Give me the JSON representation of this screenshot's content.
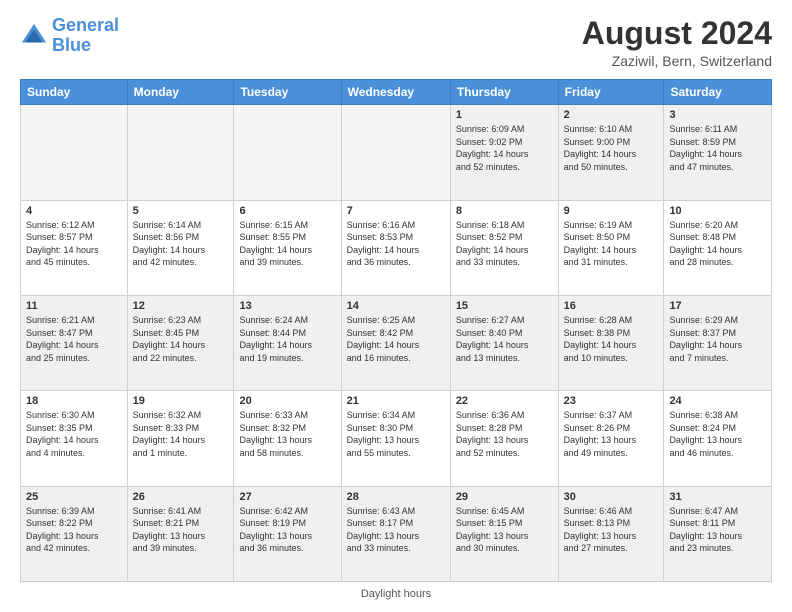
{
  "header": {
    "logo_line1": "General",
    "logo_line2": "Blue",
    "month_title": "August 2024",
    "location": "Zaziwil, Bern, Switzerland"
  },
  "footer": {
    "note": "Daylight hours"
  },
  "weekdays": [
    "Sunday",
    "Monday",
    "Tuesday",
    "Wednesday",
    "Thursday",
    "Friday",
    "Saturday"
  ],
  "weeks": [
    [
      {
        "day": "",
        "info": "",
        "empty": true
      },
      {
        "day": "",
        "info": "",
        "empty": true
      },
      {
        "day": "",
        "info": "",
        "empty": true
      },
      {
        "day": "",
        "info": "",
        "empty": true
      },
      {
        "day": "1",
        "info": "Sunrise: 6:09 AM\nSunset: 9:02 PM\nDaylight: 14 hours\nand 52 minutes.",
        "empty": false
      },
      {
        "day": "2",
        "info": "Sunrise: 6:10 AM\nSunset: 9:00 PM\nDaylight: 14 hours\nand 50 minutes.",
        "empty": false
      },
      {
        "day": "3",
        "info": "Sunrise: 6:11 AM\nSunset: 8:59 PM\nDaylight: 14 hours\nand 47 minutes.",
        "empty": false
      }
    ],
    [
      {
        "day": "4",
        "info": "Sunrise: 6:12 AM\nSunset: 8:57 PM\nDaylight: 14 hours\nand 45 minutes.",
        "empty": false
      },
      {
        "day": "5",
        "info": "Sunrise: 6:14 AM\nSunset: 8:56 PM\nDaylight: 14 hours\nand 42 minutes.",
        "empty": false
      },
      {
        "day": "6",
        "info": "Sunrise: 6:15 AM\nSunset: 8:55 PM\nDaylight: 14 hours\nand 39 minutes.",
        "empty": false
      },
      {
        "day": "7",
        "info": "Sunrise: 6:16 AM\nSunset: 8:53 PM\nDaylight: 14 hours\nand 36 minutes.",
        "empty": false
      },
      {
        "day": "8",
        "info": "Sunrise: 6:18 AM\nSunset: 8:52 PM\nDaylight: 14 hours\nand 33 minutes.",
        "empty": false
      },
      {
        "day": "9",
        "info": "Sunrise: 6:19 AM\nSunset: 8:50 PM\nDaylight: 14 hours\nand 31 minutes.",
        "empty": false
      },
      {
        "day": "10",
        "info": "Sunrise: 6:20 AM\nSunset: 8:48 PM\nDaylight: 14 hours\nand 28 minutes.",
        "empty": false
      }
    ],
    [
      {
        "day": "11",
        "info": "Sunrise: 6:21 AM\nSunset: 8:47 PM\nDaylight: 14 hours\nand 25 minutes.",
        "empty": false
      },
      {
        "day": "12",
        "info": "Sunrise: 6:23 AM\nSunset: 8:45 PM\nDaylight: 14 hours\nand 22 minutes.",
        "empty": false
      },
      {
        "day": "13",
        "info": "Sunrise: 6:24 AM\nSunset: 8:44 PM\nDaylight: 14 hours\nand 19 minutes.",
        "empty": false
      },
      {
        "day": "14",
        "info": "Sunrise: 6:25 AM\nSunset: 8:42 PM\nDaylight: 14 hours\nand 16 minutes.",
        "empty": false
      },
      {
        "day": "15",
        "info": "Sunrise: 6:27 AM\nSunset: 8:40 PM\nDaylight: 14 hours\nand 13 minutes.",
        "empty": false
      },
      {
        "day": "16",
        "info": "Sunrise: 6:28 AM\nSunset: 8:38 PM\nDaylight: 14 hours\nand 10 minutes.",
        "empty": false
      },
      {
        "day": "17",
        "info": "Sunrise: 6:29 AM\nSunset: 8:37 PM\nDaylight: 14 hours\nand 7 minutes.",
        "empty": false
      }
    ],
    [
      {
        "day": "18",
        "info": "Sunrise: 6:30 AM\nSunset: 8:35 PM\nDaylight: 14 hours\nand 4 minutes.",
        "empty": false
      },
      {
        "day": "19",
        "info": "Sunrise: 6:32 AM\nSunset: 8:33 PM\nDaylight: 14 hours\nand 1 minute.",
        "empty": false
      },
      {
        "day": "20",
        "info": "Sunrise: 6:33 AM\nSunset: 8:32 PM\nDaylight: 13 hours\nand 58 minutes.",
        "empty": false
      },
      {
        "day": "21",
        "info": "Sunrise: 6:34 AM\nSunset: 8:30 PM\nDaylight: 13 hours\nand 55 minutes.",
        "empty": false
      },
      {
        "day": "22",
        "info": "Sunrise: 6:36 AM\nSunset: 8:28 PM\nDaylight: 13 hours\nand 52 minutes.",
        "empty": false
      },
      {
        "day": "23",
        "info": "Sunrise: 6:37 AM\nSunset: 8:26 PM\nDaylight: 13 hours\nand 49 minutes.",
        "empty": false
      },
      {
        "day": "24",
        "info": "Sunrise: 6:38 AM\nSunset: 8:24 PM\nDaylight: 13 hours\nand 46 minutes.",
        "empty": false
      }
    ],
    [
      {
        "day": "25",
        "info": "Sunrise: 6:39 AM\nSunset: 8:22 PM\nDaylight: 13 hours\nand 42 minutes.",
        "empty": false
      },
      {
        "day": "26",
        "info": "Sunrise: 6:41 AM\nSunset: 8:21 PM\nDaylight: 13 hours\nand 39 minutes.",
        "empty": false
      },
      {
        "day": "27",
        "info": "Sunrise: 6:42 AM\nSunset: 8:19 PM\nDaylight: 13 hours\nand 36 minutes.",
        "empty": false
      },
      {
        "day": "28",
        "info": "Sunrise: 6:43 AM\nSunset: 8:17 PM\nDaylight: 13 hours\nand 33 minutes.",
        "empty": false
      },
      {
        "day": "29",
        "info": "Sunrise: 6:45 AM\nSunset: 8:15 PM\nDaylight: 13 hours\nand 30 minutes.",
        "empty": false
      },
      {
        "day": "30",
        "info": "Sunrise: 6:46 AM\nSunset: 8:13 PM\nDaylight: 13 hours\nand 27 minutes.",
        "empty": false
      },
      {
        "day": "31",
        "info": "Sunrise: 6:47 AM\nSunset: 8:11 PM\nDaylight: 13 hours\nand 23 minutes.",
        "empty": false
      }
    ]
  ]
}
